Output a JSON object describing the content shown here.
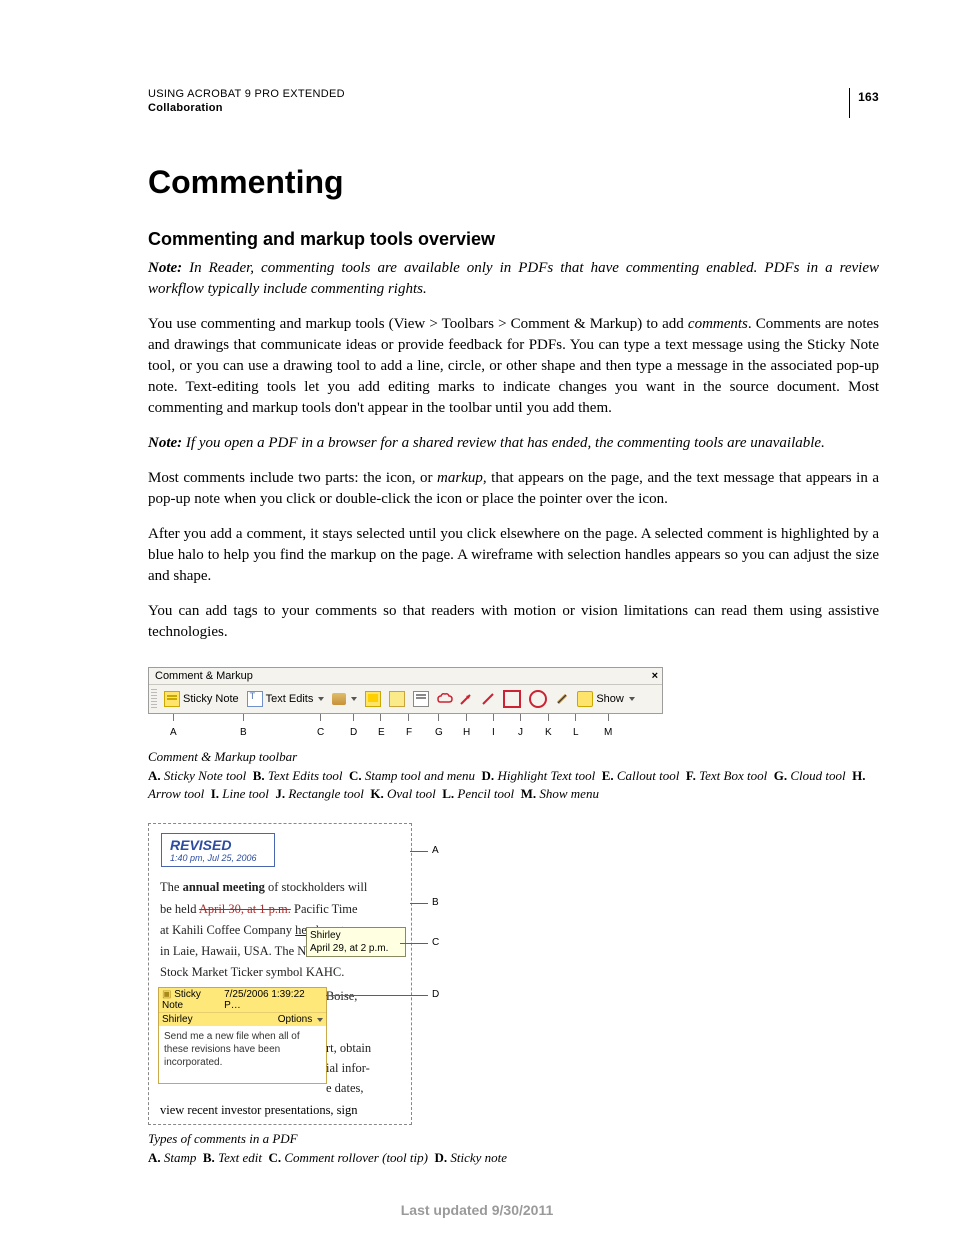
{
  "header": {
    "product": "USING ACROBAT 9 PRO EXTENDED",
    "section": "Collaboration",
    "page_number": "163"
  },
  "h1": "Commenting",
  "h2": "Commenting and markup tools overview",
  "note1_label": "Note:",
  "note1_body": " In Reader, commenting tools are available only in PDFs that have commenting enabled. PDFs in a review workflow typically include commenting rights.",
  "p1_a": "You use commenting and markup tools (View > Toolbars > Comment & Markup) to add ",
  "p1_i": "comments",
  "p1_b": ". Comments are notes and drawings that communicate ideas or provide feedback for PDFs. You can type a text message using the Sticky Note tool, or you can use a drawing tool to add a line, circle, or other shape and then type a message in the associated pop-up note. Text-editing tools let you add editing marks to indicate changes you want in the source document. Most commenting and markup tools don't appear in the toolbar until you add them.",
  "note2_label": "Note:",
  "note2_body": " If you open a PDF in a browser for a shared review that has ended, the commenting tools are unavailable.",
  "p2_a": "Most comments include two parts: the icon, or ",
  "p2_i": "markup",
  "p2_b": ", that appears on the page, and the text message that appears in a pop-up note when you click or double-click the icon or place the pointer over the icon.",
  "p3": "After you add a comment, it stays selected until you click elsewhere on the page. A selected comment is highlighted by a blue halo to help you find the markup on the page. A wireframe with selection handles appears so you can adjust the size and shape.",
  "p4": "You can add tags to your comments so that readers with motion or vision limitations can read them using assistive technologies.",
  "toolbar": {
    "title": "Comment & Markup",
    "close": "×",
    "sticky": "Sticky Note",
    "tedit": "Text Edits",
    "show": "Show",
    "letters": [
      "A",
      "B",
      "C",
      "D",
      "E",
      "F",
      "G",
      "H",
      "I",
      "J",
      "K",
      "L",
      "M"
    ]
  },
  "caption1": "Comment & Markup toolbar",
  "legend1": {
    "A": "Sticky Note tool",
    "B": "Text Edits tool",
    "C": "Stamp tool and menu",
    "D": "Highlight Text tool",
    "E": "Callout tool",
    "F": "Text Box tool",
    "G": "Cloud tool",
    "H": "Arrow tool",
    "I": "Line tool",
    "J": "Rectangle tool",
    "K": "Oval tool",
    "L": "Pencil tool",
    "M": "Show menu"
  },
  "fig2": {
    "stamp_title": "REVISED",
    "stamp_time": "1:40 pm, Jul 25, 2006",
    "line1_a": "The ",
    "line1_b": "annual meeting",
    "line1_c": " of stockholders will",
    "line2_a": "be held ",
    "line2_strike": "April 30, at 1 p.m.",
    "line2_b": " Pacific Time",
    "line3_a": "at Kahili Coffee Company ",
    "line3_ul": "headquarters",
    "line4": "in Laie, Hawaii, USA. The N",
    "line5": "Stock Market Ticker symbol KAHC.",
    "line6": "Independent Auditors: DJL LLP, Boise,",
    "tooltip_name": "Shirley",
    "tooltip_text": "April 29, at 2 p.m.",
    "sticky_hdr_label": "Sticky Note",
    "sticky_hdr_time": "7/25/2006 1:39:22 P…",
    "sticky_sub_name": "Shirley",
    "sticky_sub_opts": "Options",
    "sticky_body": "Send me a new file when all of these revisions have been incorporated.",
    "side1": "rt, obtain",
    "side2": "ial infor-",
    "side3": "e dates,",
    "bottom": "view recent investor presentations, sign",
    "labels": {
      "A": "A",
      "B": "B",
      "C": "C",
      "D": "D"
    }
  },
  "caption2": "Types of comments in a PDF",
  "legend2": {
    "A": "Stamp",
    "B": "Text edit",
    "C": "Comment rollover (tool tip)",
    "D": "Sticky note"
  },
  "footer": "Last updated 9/30/2011"
}
